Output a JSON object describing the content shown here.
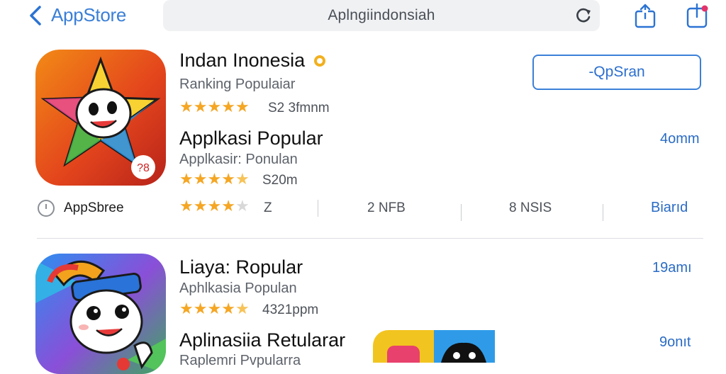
{
  "topbar": {
    "back_label": "AppStore",
    "search_query": "Aplngiindonsiah"
  },
  "apps": [
    {
      "title": "Indan Inonesia",
      "subtitle": "Ranking Populaiar",
      "rating_text": "S2 3fmnm",
      "action_label": "-QpSran"
    },
    {
      "title": "Applkasi Popular",
      "subtitle": "Applkasir: Ponulan",
      "rating_text": "S20m",
      "side_link": "4omm"
    },
    {
      "title": "Liaya: Ropular",
      "subtitle": "Aphlkasia Populan",
      "rating_text": "4321ppm",
      "side_link": "19amı"
    },
    {
      "title": "Aplinasiia Retularar",
      "subtitle": "Raplemri Pvpularra",
      "side_link": "9onıt"
    }
  ],
  "statsrow": {
    "source_label": "AppSbree",
    "rating_value": "Z",
    "stat1": "2 NFB",
    "stat2": "8 NSIS",
    "stat3": "Biarıd"
  },
  "badge_text": "?8",
  "colors": {
    "accent": "#2a6bc5",
    "star": "#f5a623"
  },
  "icons": [
    "back-chevron-icon",
    "reload-icon",
    "share-icon",
    "share-badge-icon",
    "star-icon",
    "clock-icon"
  ]
}
